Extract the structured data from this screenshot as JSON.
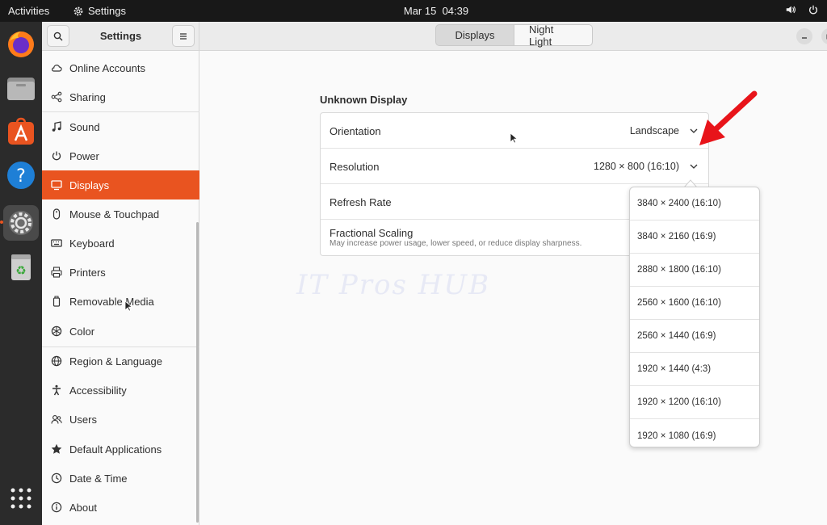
{
  "topbar": {
    "activities": "Activities",
    "app_name": "Settings",
    "date": "Mar 15",
    "time": "04:39"
  },
  "dock": {
    "apps": [
      "firefox-icon",
      "files-icon",
      "app-center-icon",
      "help-icon",
      "settings-icon",
      "trash-icon",
      "show-apps-icon"
    ]
  },
  "window": {
    "sidebar_title": "Settings",
    "tabs": [
      {
        "label": "Displays",
        "active": true
      },
      {
        "label": "Night Light",
        "active": false
      }
    ]
  },
  "sidebar": {
    "items": [
      {
        "label": "Online Accounts",
        "icon": "cloud-icon"
      },
      {
        "label": "Sharing",
        "icon": "share-icon"
      },
      {
        "label": "Sound",
        "icon": "music-note-icon"
      },
      {
        "label": "Power",
        "icon": "power-icon"
      },
      {
        "label": "Displays",
        "icon": "display-icon",
        "selected": true
      },
      {
        "label": "Mouse & Touchpad",
        "icon": "mouse-icon"
      },
      {
        "label": "Keyboard",
        "icon": "keyboard-icon"
      },
      {
        "label": "Printers",
        "icon": "printer-icon"
      },
      {
        "label": "Removable Media",
        "icon": "removable-media-icon"
      },
      {
        "label": "Color",
        "icon": "color-icon"
      },
      {
        "label": "Region & Language",
        "icon": "globe-icon"
      },
      {
        "label": "Accessibility",
        "icon": "accessibility-icon"
      },
      {
        "label": "Users",
        "icon": "users-icon"
      },
      {
        "label": "Default Applications",
        "icon": "star-icon"
      },
      {
        "label": "Date & Time",
        "icon": "clock-icon"
      },
      {
        "label": "About",
        "icon": "info-icon"
      }
    ]
  },
  "display": {
    "section_title": "Unknown Display",
    "orientation": {
      "label": "Orientation",
      "value": "Landscape"
    },
    "resolution": {
      "label": "Resolution",
      "value": "1280 × 800 (16:10)"
    },
    "refresh_rate": {
      "label": "Refresh Rate"
    },
    "fractional_scaling": {
      "label": "Fractional Scaling",
      "description": "May increase power usage, lower speed, or reduce display sharpness."
    }
  },
  "resolution_options": [
    "3840 × 2400 (16:10)",
    "3840 × 2160 (16:9)",
    "2880 × 1800 (16:10)",
    "2560 × 1600 (16:10)",
    "2560 × 1440 (16:9)",
    "1920 × 1440 (4:3)",
    "1920 × 1200 (16:10)",
    "1920 × 1080 (16:9)"
  ],
  "watermark": "IT Pros HUB",
  "colors": {
    "accent": "#e95420",
    "annotation_arrow": "#e8141a",
    "topbar": "#181818",
    "dock": "#2b2b2b"
  }
}
